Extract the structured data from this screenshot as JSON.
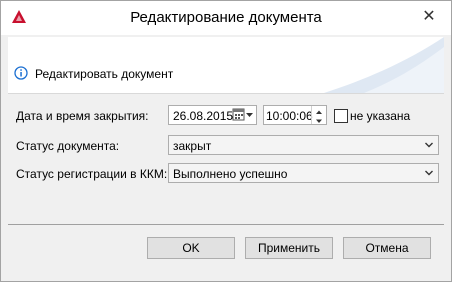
{
  "window": {
    "title": "Редактирование документа",
    "close_glyph": "✕"
  },
  "banner": {
    "text": "Редактировать документ",
    "icon": "info-icon"
  },
  "form": {
    "close_datetime_label": "Дата и время закрытия:",
    "date_value": "26.08.2015",
    "time_value": "10:00:06",
    "not_specified_label": "не указана",
    "doc_status_label": "Статус документа:",
    "doc_status_value": "закрыт",
    "kkm_status_label": "Статус регистрации в ККМ:",
    "kkm_status_value": "Выполнено успешно"
  },
  "buttons": {
    "ok": "OK",
    "apply": "Применить",
    "cancel": "Отмена"
  },
  "colors": {
    "info_blue": "#1b6fd1",
    "app_icon_red": "#c8102e",
    "swoosh": "#dfe8f3"
  }
}
